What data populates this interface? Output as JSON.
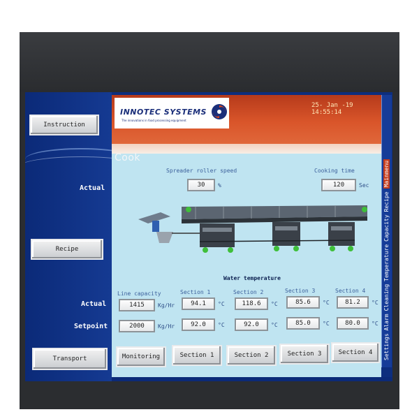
{
  "header": {
    "brand": "INNOTEC SYSTEMS",
    "tagline": "The innovations in food processing equipment",
    "datetime": "25- Jan -19 14:55:14"
  },
  "nav": {
    "instruction": "Instruction",
    "recipe": "Recipe",
    "transport": "Transport"
  },
  "labels": {
    "actual": "Actual",
    "setpoint": "Setpoint"
  },
  "page_title": "Cook",
  "spreader": {
    "caption": "Spreader roller speed",
    "value": "30",
    "unit": "%"
  },
  "cooking_time": {
    "caption": "Cooking time",
    "value": "120",
    "unit": "Sec"
  },
  "diagram": {
    "caption": "Water temperature"
  },
  "line_capacity": {
    "caption": "Line capacity",
    "actual": "1415",
    "setpoint": "2000",
    "unit": "Kg/Hr"
  },
  "sections": [
    {
      "caption": "Section 1",
      "actual": "94.1",
      "setpoint": "92.0",
      "unit": "°C"
    },
    {
      "caption": "Section 2",
      "actual": "118.6",
      "setpoint": "92.0",
      "unit": "°C"
    },
    {
      "caption": "Section 3",
      "actual": "85.6",
      "setpoint": "85.0",
      "unit": "°C"
    },
    {
      "caption": "Section 4",
      "actual": "81.2",
      "setpoint": "80.0",
      "unit": "°C"
    }
  ],
  "bottom_tabs": [
    "Monitoring",
    "Section 1",
    "Section 2",
    "Section 3",
    "Section 4"
  ],
  "side_menu": [
    "Settings",
    "Alarm",
    "Cleaning",
    "Temperature",
    "Capacity",
    "Recipe",
    "Mainmenu"
  ],
  "colors": {
    "screen_blue": "#0d2e7e",
    "header_orange": "#d9552a",
    "main_cyan": "#bfe4f1",
    "indicator_green": "#3fbf3a"
  }
}
